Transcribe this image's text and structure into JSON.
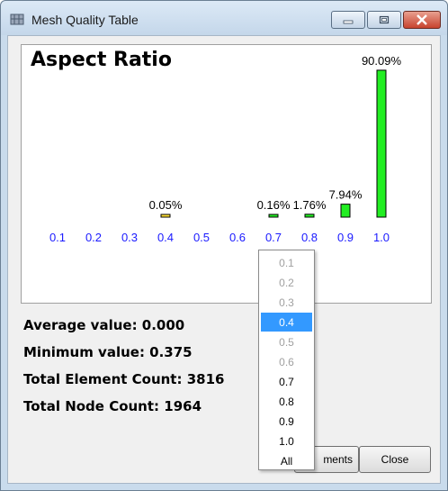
{
  "window": {
    "title": "Mesh Quality Table",
    "controls": [
      "minimize",
      "maximize",
      "close"
    ]
  },
  "chart_data": {
    "type": "bar",
    "title": "Aspect Ratio",
    "categories": [
      "0.1",
      "0.2",
      "0.3",
      "0.4",
      "0.5",
      "0.6",
      "0.7",
      "0.8",
      "0.9",
      "1.0"
    ],
    "values": [
      0,
      0,
      0,
      0.05,
      0,
      0,
      0.16,
      1.76,
      7.94,
      90.09
    ],
    "labels": [
      "",
      "",
      "",
      "0.05%",
      "",
      "",
      "0.16%",
      "1.76%",
      "7.94%",
      "90.09%"
    ],
    "bar_colors": [
      "",
      "",
      "",
      "#ffe033",
      "",
      "",
      "#22ee22",
      "#22ee22",
      "#22ee22",
      "#22ee22"
    ],
    "tick_color": "#1a1aff",
    "ylim": [
      0,
      100
    ],
    "grid": false,
    "legend": "none"
  },
  "stats": {
    "average": "Average value: 0.000",
    "minimum": "Minimum value: 0.375",
    "elements": "Total Element Count: 3816",
    "nodes": "Total Node Count: 1964"
  },
  "buttons": {
    "elements_label": "ments",
    "close_label": "Close"
  },
  "dropdown": {
    "items": [
      {
        "label": "0.1",
        "state": "disabled"
      },
      {
        "label": "0.2",
        "state": "disabled"
      },
      {
        "label": "0.3",
        "state": "disabled"
      },
      {
        "label": "0.4",
        "state": "selected"
      },
      {
        "label": "0.5",
        "state": "disabled"
      },
      {
        "label": "0.6",
        "state": "disabled"
      },
      {
        "label": "0.7",
        "state": "enabled"
      },
      {
        "label": "0.8",
        "state": "enabled"
      },
      {
        "label": "0.9",
        "state": "enabled"
      },
      {
        "label": "1.0",
        "state": "enabled"
      },
      {
        "label": "All",
        "state": "enabled"
      }
    ]
  }
}
